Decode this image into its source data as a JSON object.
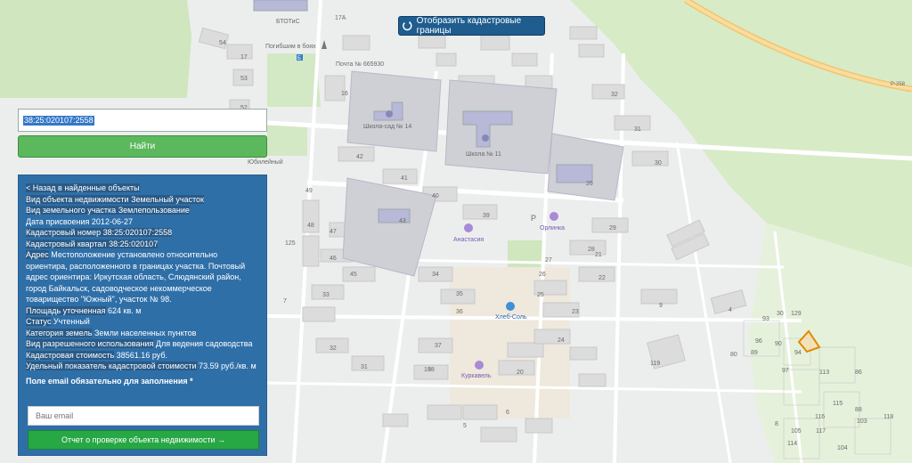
{
  "toolbar": {
    "cadastral_button_label": "Отобразить кадастровые границы"
  },
  "search": {
    "value": "38:25:020107:2558",
    "find_button_label": "Найти"
  },
  "panel": {
    "back_link": "< Назад в найденные объекты",
    "property_type_label": "Вид объекта недвижимости",
    "property_type_value": "Земельный участок",
    "land_type_label": "Вид земельного участка",
    "land_type_value": "Землепользование",
    "date_label": "Дата присвоения",
    "date_value": "2012-06-27",
    "cad_number_label": "Кадастровый номер",
    "cad_number_value": "38:25:020107:2558",
    "cad_quarter_label": "Кадастровый квартал",
    "cad_quarter_value": "38:25:020107",
    "address_label": "Адрес",
    "address_value": "Местоположение установлено относительно ориентира, расположенного в границах участка. Почтовый адрес ориентира: Иркутская область, Слюдянский район, город Байкальск, садоводческое некоммерческое товарищество \"Южный\", участок № 98.",
    "area_label": "Площадь уточненная",
    "area_value": "624 кв. м",
    "status_label": "Статус",
    "status_value": "Учтенный",
    "category_label": "Категория земель",
    "category_value": "Земли населенных пунктов",
    "usage_label": "Вид разрешенного использования",
    "usage_value": "Для ведения садоводства",
    "cost_label": "Кадастровая стоимость",
    "cost_value": "38561.16 руб.",
    "specific_label": "Удельный показатель кадастровой стоимости",
    "specific_value": "73.59 руб./кв. м",
    "email_label": "Поле email обязательно для заполнения *",
    "email_placeholder": "Ваш email",
    "report_button": "Отчет о проверке объекта недвижимости →"
  },
  "map": {
    "poi": {
      "btotis": "БТОТиС",
      "pogibshim": "Погибшим в боях",
      "pochta": "Почта № 665930",
      "school14": "Школа-сад № 14",
      "school11": "Школа № 11",
      "yubileyny": "Юбилейный",
      "anastasia": "Анастасия",
      "orlinka": "Орлинка",
      "hleb_sol": "Хлеб-Соль",
      "kurkavel": "Куркавель",
      "road_r258": "Р-258",
      "parking": "Р",
      "bus_stop": "Б",
      "n17a": "17А"
    },
    "house_numbers": [
      "54",
      "17",
      "53",
      "16",
      "52",
      "32",
      "31",
      "30",
      "26",
      "29",
      "28",
      "42",
      "41",
      "40",
      "39",
      "45",
      "46",
      "47",
      "48",
      "49",
      "43",
      "34",
      "35",
      "36",
      "37",
      "38",
      "27",
      "25",
      "26",
      "23",
      "24",
      "22",
      "21",
      "20",
      "19",
      "33",
      "32",
      "31",
      "30",
      "129",
      "93",
      "90",
      "94",
      "97",
      "96",
      "80",
      "89",
      "86",
      "88",
      "103",
      "104",
      "105",
      "114",
      "115",
      "116",
      "117",
      "118",
      "119",
      "113",
      "8",
      "9",
      "4",
      "5",
      "6",
      "7",
      "125",
      "126"
    ]
  }
}
